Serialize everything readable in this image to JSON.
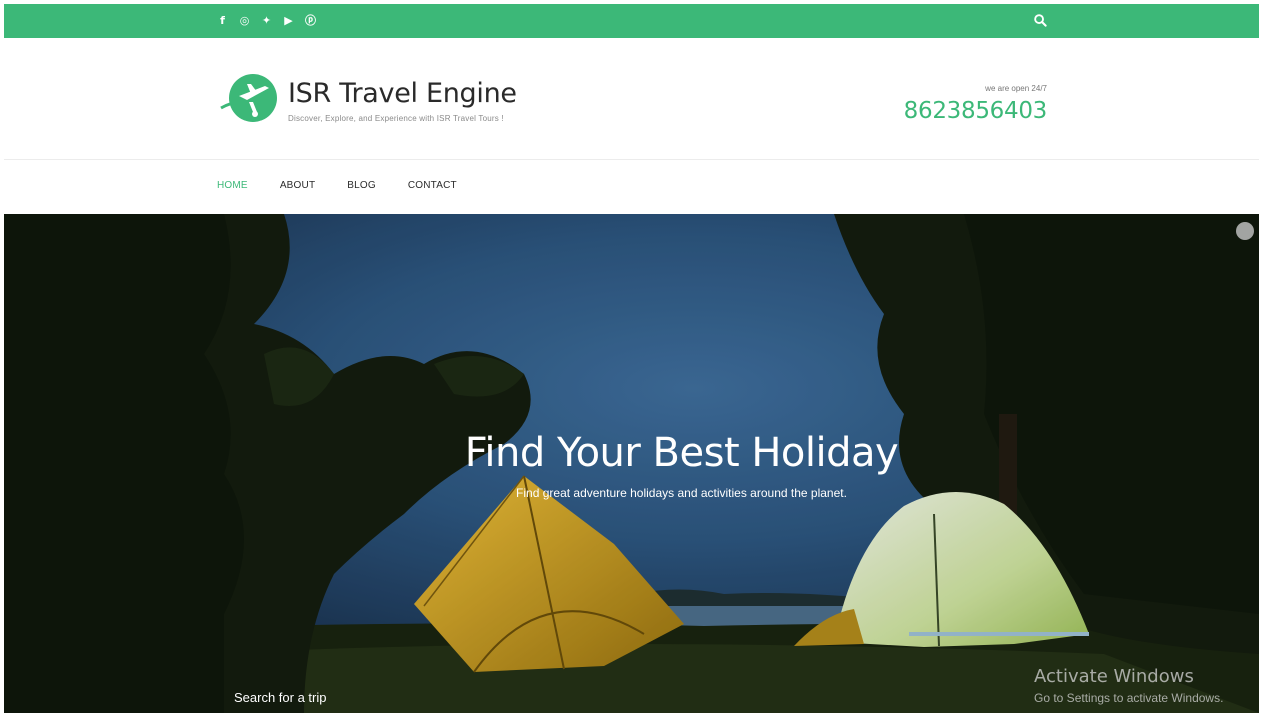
{
  "topbar": {
    "social_icons": [
      "facebook-icon",
      "instagram-icon",
      "twitter-icon",
      "youtube-icon",
      "pinterest-icon"
    ],
    "social_glyphs": [
      "f",
      "◎",
      "✦",
      "▶",
      "ⓟ"
    ],
    "accent": "#3cb878"
  },
  "header": {
    "site_title": "ISR Travel Engine",
    "tagline": "Discover, Explore, and Experience with ISR Travel Tours !",
    "open_note": "we are open 24/7",
    "phone": "8623856403"
  },
  "nav": {
    "items": [
      {
        "label": "HOME",
        "active": true
      },
      {
        "label": "ABOUT",
        "active": false
      },
      {
        "label": "BLOG",
        "active": false
      },
      {
        "label": "CONTACT",
        "active": false
      }
    ]
  },
  "hero": {
    "title": "Find Your Best Holiday",
    "subtitle": "Find great adventure holidays and activities around the planet.",
    "search_label": "Search for a trip"
  },
  "watermark": {
    "line1": "Activate Windows",
    "line2": "Go to Settings to activate Windows."
  }
}
